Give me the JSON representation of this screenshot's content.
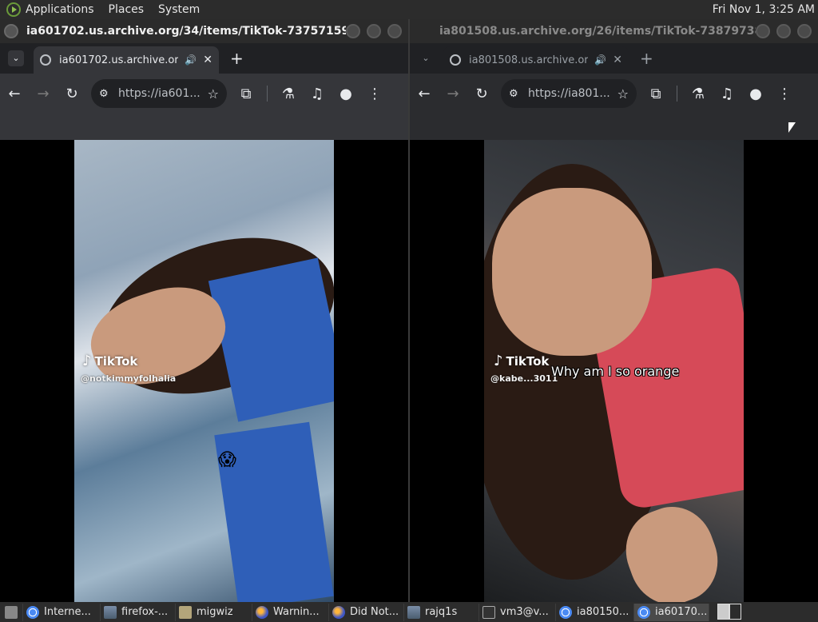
{
  "top_panel": {
    "menus": [
      "Applications",
      "Places",
      "System"
    ],
    "clock": "Fri Nov  1,  3:25 AM"
  },
  "windows": [
    {
      "window_title": "ia601702.us.archive.org/34/items/TikTok-737571599941430...",
      "tab_title": "ia601702.us.archive.org/3",
      "url": "https://ia601...",
      "video": {
        "watermark": "TikTok",
        "handle": "@notkimmyfolhalia",
        "caption": "",
        "emoji": "😱"
      }
    },
    {
      "window_title": "ia801508.us.archive.org/26/items/TikTok-738797383789324...",
      "tab_title": "ia801508.us.archive.org/",
      "url": "https://ia801...",
      "video": {
        "watermark": "TikTok",
        "handle": "@kabe...3011",
        "caption": "Why am I so orange",
        "emoji": ""
      }
    }
  ],
  "icons": {
    "back": "←",
    "forward": "→",
    "reload": "↻",
    "star": "☆",
    "extensions": "⧉",
    "labs": "⚗",
    "media": "♫",
    "profile": "●",
    "menu": "⋮",
    "tabmenu": "⌄",
    "newtab": "+",
    "close": "✕",
    "audio": "🔊",
    "site_settings": "⚙"
  },
  "taskbar": {
    "items": [
      {
        "label": "Interne...",
        "icon": "chrome-icon"
      },
      {
        "label": "firefox-...",
        "icon": "image-icon"
      },
      {
        "label": "migwiz",
        "icon": "folder-icon"
      },
      {
        "label": "Warnin...",
        "icon": "firefox-icon"
      },
      {
        "label": "Did Not...",
        "icon": "firefox-icon"
      },
      {
        "label": "rajq1s",
        "icon": "image-icon"
      },
      {
        "label": "vm3@v...",
        "icon": "terminal-icon"
      },
      {
        "label": "ia80150...",
        "icon": "chrome-icon"
      },
      {
        "label": "ia60170...",
        "icon": "chrome-icon"
      }
    ]
  }
}
